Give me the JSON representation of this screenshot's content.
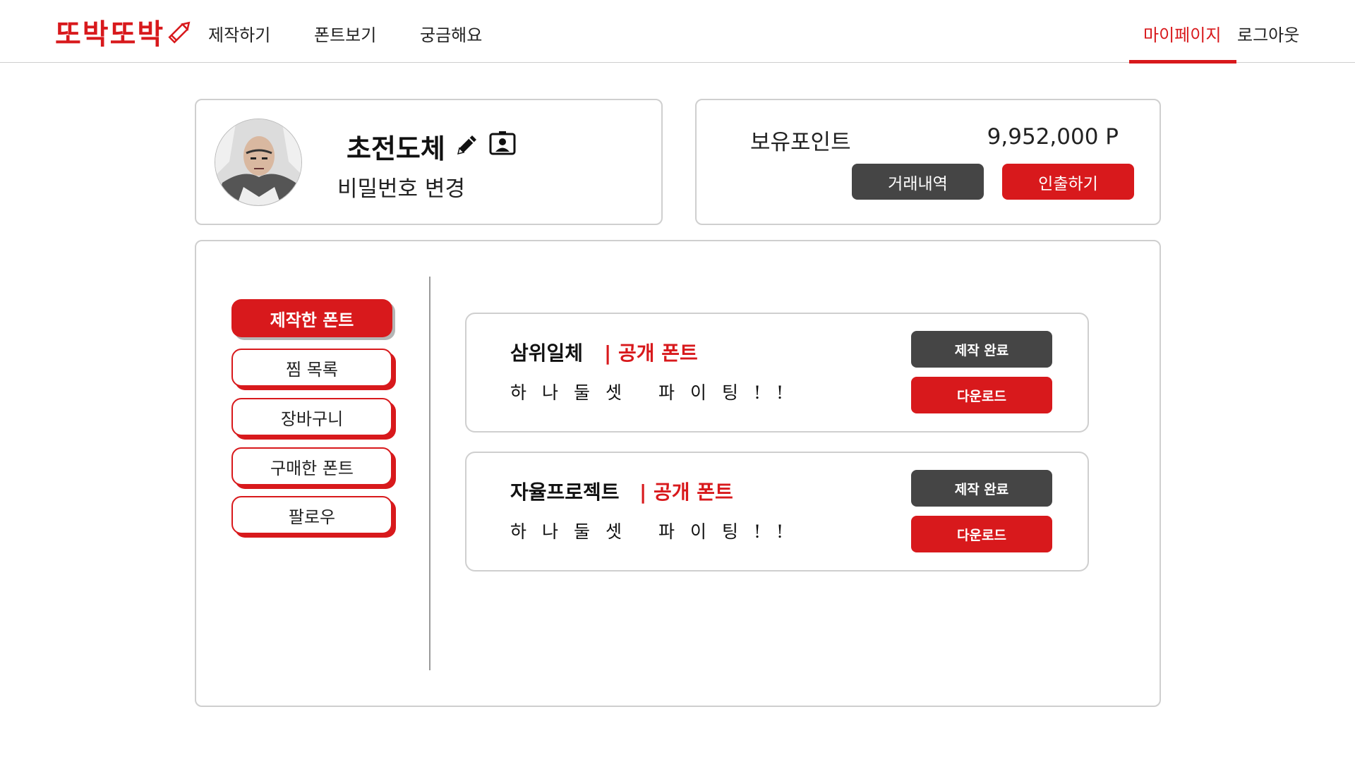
{
  "header": {
    "logo": "또박또박",
    "nav": {
      "make": "제작하기",
      "fonts": "폰트보기",
      "faq": "궁금해요",
      "mypage": "마이페이지",
      "logout": "로그아웃"
    },
    "active_tab": "마이페이지"
  },
  "profile": {
    "name": "초전도체",
    "change_password": "비밀번호 변경"
  },
  "points": {
    "label": "보유포인트",
    "value": "9,952,000 P",
    "history_button": "거래내역",
    "withdraw_button": "인출하기"
  },
  "sidebar": {
    "items": [
      {
        "label": "제작한 폰트",
        "active": true
      },
      {
        "label": "찜 목록",
        "active": false
      },
      {
        "label": "장바구니",
        "active": false
      },
      {
        "label": "구매한 폰트",
        "active": false
      },
      {
        "label": "팔로우",
        "active": false
      }
    ]
  },
  "fonts": [
    {
      "name": "삼위일체",
      "tag": "| 공개 폰트",
      "sample": "하나둘셋 파이팅!!",
      "status_button": "제작 완료",
      "download_button": "다운로드"
    },
    {
      "name": "자율프로젝트",
      "tag": "| 공개 폰트",
      "sample": "하나둘셋 파이팅!!",
      "status_button": "제작 완료",
      "download_button": "다운로드"
    }
  ],
  "colors": {
    "accent": "#d8191c",
    "dark_button": "#454545",
    "border": "#cfcfcf"
  },
  "icons": {
    "logo": "pencil-icon",
    "edit": "pencil-icon",
    "profile": "contact-card-icon"
  }
}
